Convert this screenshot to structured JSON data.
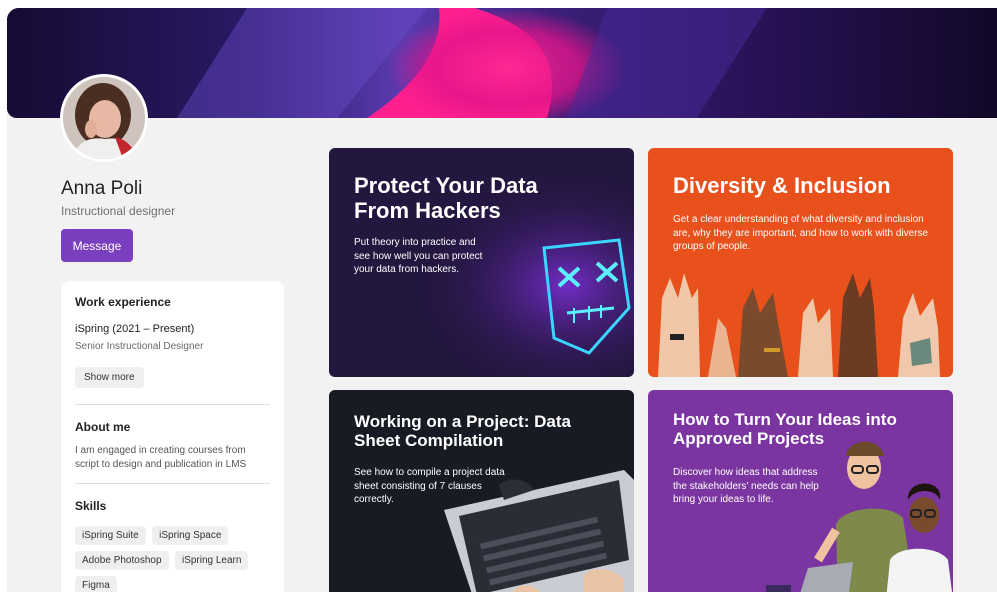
{
  "profile": {
    "name": "Anna Poli",
    "role": "Instructional designer",
    "message_label": "Message"
  },
  "work": {
    "heading": "Work experience",
    "company": "iSpring (2021 – Present)",
    "position": "Senior Instructional Designer",
    "show_more": "Show more"
  },
  "about": {
    "heading": "About me",
    "text": "I am engaged in creating courses from script to design and publication in LMS"
  },
  "skills": {
    "heading": "Skills",
    "items": [
      "iSpring Suite",
      "iSpring Space",
      "Adobe Photoshop",
      "iSpring Learn",
      "Figma"
    ]
  },
  "courses": [
    {
      "title": "Protect Your Data From Hackers",
      "description": "Put theory into practice and see how well you can protect your data from hackers.",
      "color": "#23163f"
    },
    {
      "title": "Diversity & Inclusion",
      "description": "Get a clear understanding of what diversity and inclusion are, why they are important, and how to work with diverse groups of people.",
      "color": "#e8501c"
    },
    {
      "title": "Working on a Project: Data Sheet Compilation",
      "description": "See how to compile a project data sheet consisting of 7 clauses correctly.",
      "color": "#181b24"
    },
    {
      "title": "How to Turn Your Ideas into Approved Projects",
      "description": "Discover how ideas that address the stakeholders’ needs can help bring your ideas to life.",
      "color": "#7b35a0"
    }
  ],
  "colors": {
    "accent": "#7a3fbf",
    "banner_pink": "#ff1f8e",
    "banner_dark": "#1b0f3d"
  }
}
